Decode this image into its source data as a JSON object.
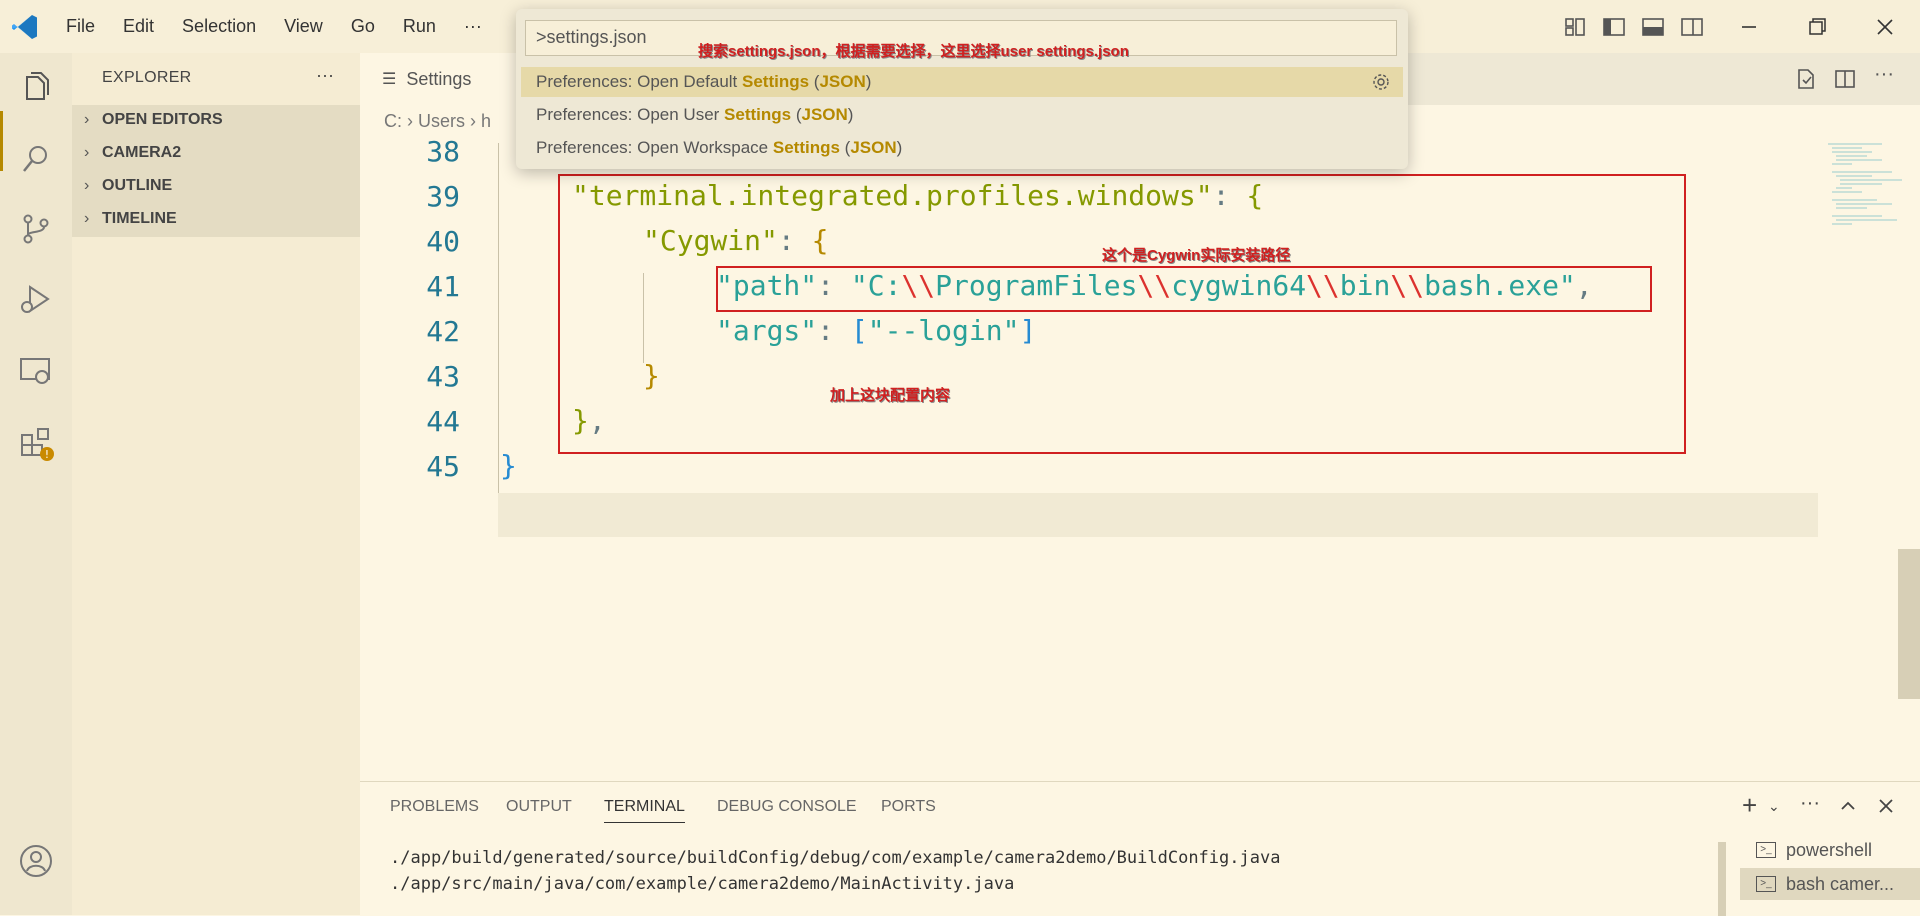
{
  "menu": [
    "File",
    "Edit",
    "Selection",
    "View",
    "Go",
    "Run",
    "···"
  ],
  "sidebar": {
    "title": "EXPLORER",
    "more": "···",
    "sections": [
      "OPEN EDITORS",
      "CAMERA2",
      "OUTLINE",
      "TIMELINE"
    ]
  },
  "editor": {
    "tab_label": "Settings",
    "breadcrumb": [
      "C:",
      "Users",
      "h"
    ],
    "line_numbers": [
      "38",
      "39",
      "40",
      "41",
      "42",
      "43",
      "44",
      "45"
    ]
  },
  "command_palette": {
    "input_value": ">settings.json",
    "items": [
      {
        "prefix": "Preferences: Open Default ",
        "hl": "Settings",
        "mid": " (",
        "hl2": "JSON",
        "suffix": ")"
      },
      {
        "prefix": "Preferences: Open User ",
        "hl": "Settings",
        "mid": " (",
        "hl2": "JSON",
        "suffix": ")"
      },
      {
        "prefix": "Preferences: Open Workspace ",
        "hl": "Settings",
        "mid": " (",
        "hl2": "JSON",
        "suffix": ")"
      }
    ]
  },
  "annotations": {
    "search_note": "搜索settings.json，根据需要选择，这里选择user settings.json",
    "path_note": "这个是Cygwin实际安装路径",
    "add_note": "加上这块配置内容"
  },
  "panel": {
    "tabs": [
      "PROBLEMS",
      "OUTPUT",
      "TERMINAL",
      "DEBUG CONSOLE",
      "PORTS"
    ],
    "terminal_lines": [
      "./app/build/generated/source/buildConfig/debug/com/example/camera2demo/BuildConfig.java",
      "./app/src/main/java/com/example/camera2demo/MainActivity.java"
    ],
    "terminals": [
      "powershell",
      "bash camer..."
    ]
  },
  "colors": {
    "accent": "#b58900",
    "annotation_red": "#d02020",
    "background": "#fdf6e3"
  }
}
